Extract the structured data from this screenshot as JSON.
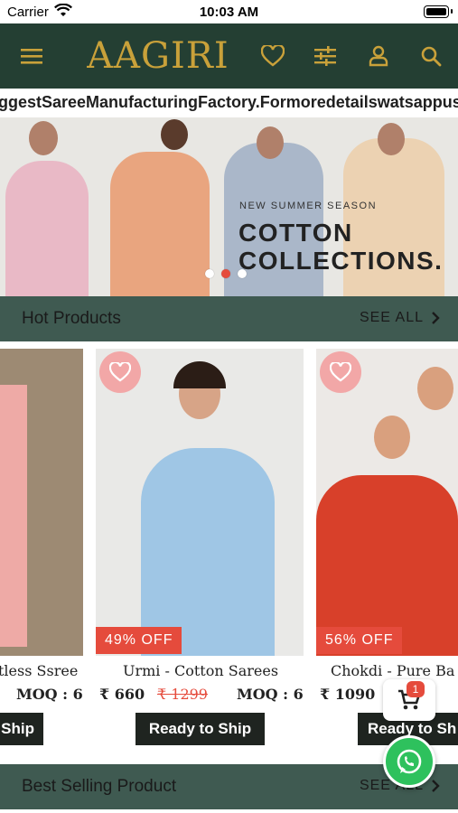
{
  "status_bar": {
    "carrier": "Carrier",
    "time": "10:03 AM"
  },
  "header": {
    "logo_text": "AAGIRI",
    "icons": [
      "menu-icon",
      "heart-icon",
      "filter-icon",
      "user-icon",
      "search-icon"
    ]
  },
  "marquee": {
    "text": "ggestSareeManufacturingFactory.Formoredetailswatsappus"
  },
  "banner": {
    "tag": "NEW SUMMER SEASON",
    "headline_line1": "COTTON",
    "headline_line2": "COLLECTIONS.",
    "dots": 3,
    "active_dot": 1
  },
  "hot_products": {
    "title": "Hot Products",
    "see_all": "SEE ALL",
    "products": [
      {
        "name": "tless Ssree",
        "price": "",
        "mrp": "",
        "moq": "MOQ : 6",
        "discount": "",
        "button": "Ship"
      },
      {
        "name": "Urmi - Cotton Sarees",
        "price": "₹ 660",
        "mrp": "₹ 1299",
        "moq": "MOQ : 6",
        "discount": "49% OFF",
        "button": "Ready to Ship"
      },
      {
        "name": "Chokdi - Pure Ba",
        "price": "₹ 1090",
        "mrp": "",
        "moq": "",
        "discount": "56% OFF",
        "button": "Ready to Sh"
      }
    ]
  },
  "best_selling": {
    "title": "Best Selling Product",
    "see_all": "SEE ALL"
  },
  "cart": {
    "count": "1"
  },
  "colors": {
    "header_bg": "#243f33",
    "gold": "#c9a13a",
    "accent_red": "#e54b3c",
    "section_bg": "#3f5a51",
    "wish_bg": "#f2a7a7"
  }
}
